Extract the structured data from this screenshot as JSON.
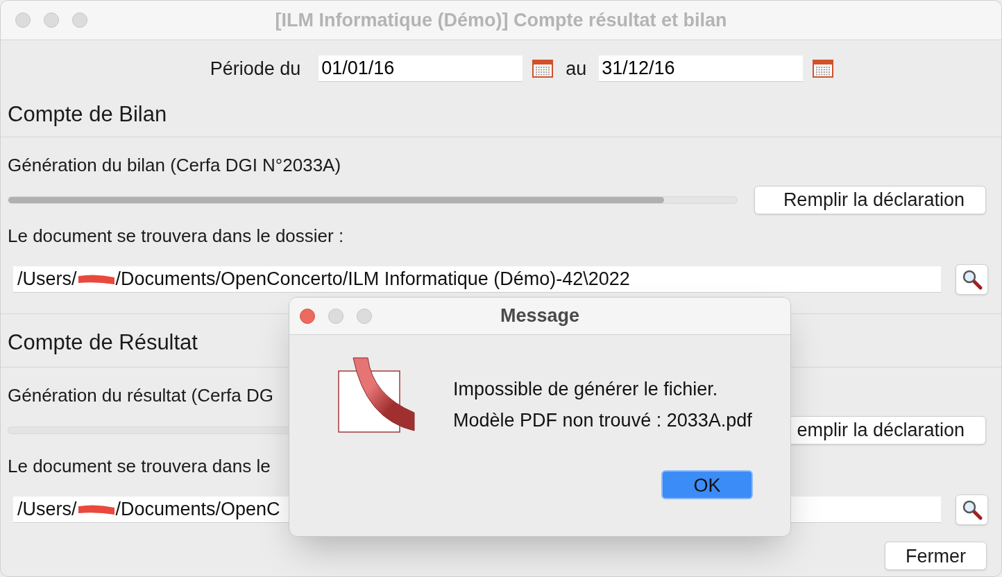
{
  "window": {
    "title": "[ILM Informatique (Démo)] Compte résultat et bilan"
  },
  "period": {
    "label": "Période du",
    "from": "01/01/16",
    "to_label": "au",
    "to": "31/12/16"
  },
  "sections": [
    {
      "title": "Compte de Bilan",
      "generation_label": "Génération du bilan (Cerfa DGI N°2033A)",
      "level": 0.9,
      "button": "Remplir la déclaration",
      "folder_label": "Le document se trouvera dans le dossier :",
      "path_prefix": "/Users/",
      "path_suffix": "/Documents/OpenConcerto/ILM Informatique (Démo)-42\\2022"
    },
    {
      "title": "Compte de Résultat",
      "generation_label": "Génération du résultat (Cerfa DG",
      "button": "emplir la déclaration",
      "folder_label": "Le document se trouvera dans le",
      "path_prefix": "/Users/",
      "path_suffix": "/Documents/OpenC"
    }
  ],
  "close_button": "Fermer",
  "dialog": {
    "title": "Message",
    "lines": [
      "Impossible de générer le fichier.",
      "Modèle PDF non trouvé : 2033A.pdf"
    ],
    "button": "OK"
  }
}
